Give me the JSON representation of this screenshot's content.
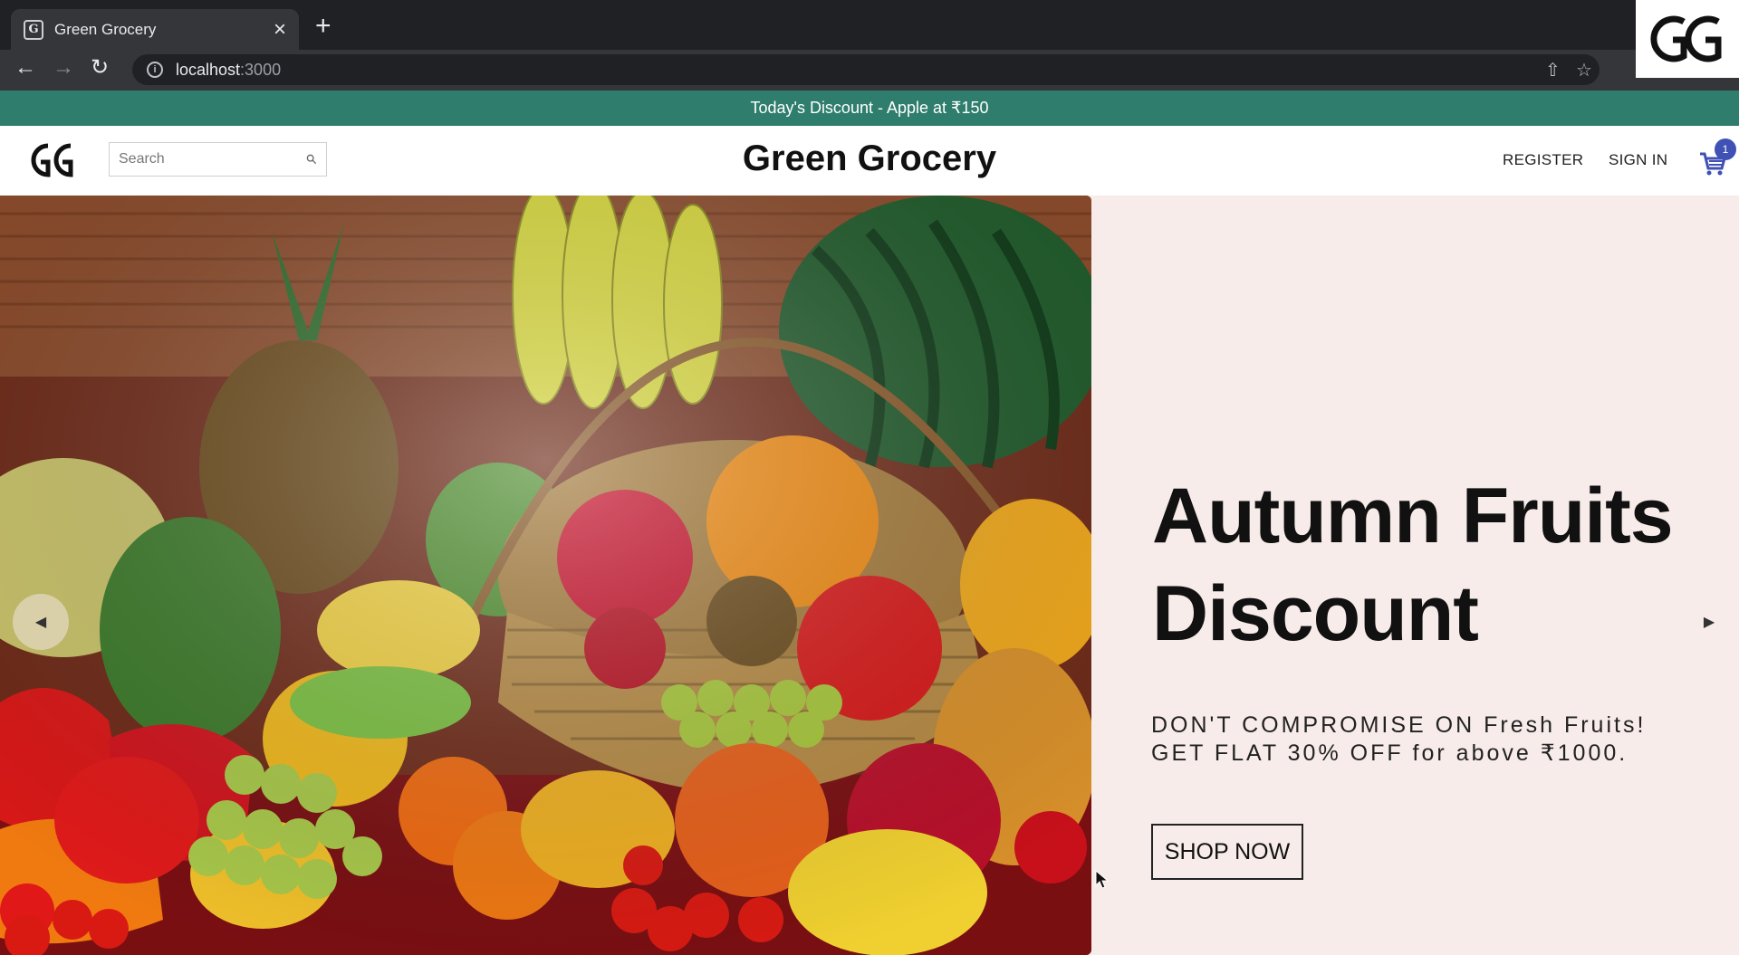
{
  "browser": {
    "tab_title": "Green Grocery",
    "tab_close": "×",
    "new_tab": "+",
    "url_host": "localhost",
    "url_port": ":3000"
  },
  "announcement": "Today's Discount - Apple at ₹150",
  "header": {
    "search_placeholder": "Search",
    "brand": "Green Grocery",
    "register": "REGISTER",
    "sign_in": "SIGN IN",
    "cart_count": "1"
  },
  "hero": {
    "title_line1": "Autumn Fruits",
    "title_line2": "Discount",
    "sub_line1": "DON'T COMPROMISE ON Fresh Fruits!",
    "sub_line2": "GET FLAT 30% OFF for above ₹1000.",
    "cta": "SHOP NOW"
  },
  "colors": {
    "announcement_bg": "#2f7d6d",
    "hero_bg": "#f7ece9",
    "cart_badge": "#3f51b5"
  }
}
